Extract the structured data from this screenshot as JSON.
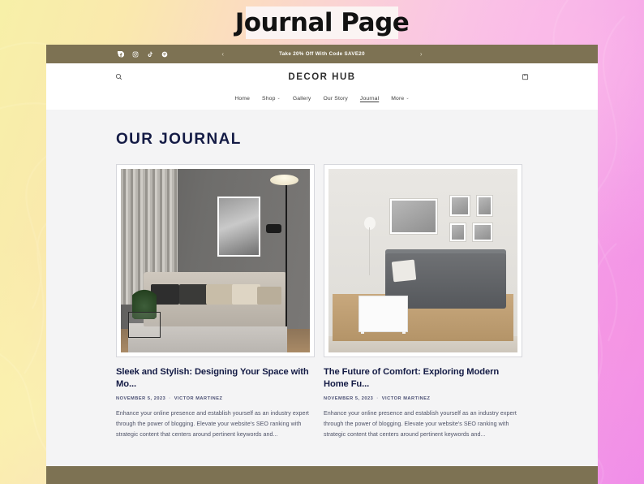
{
  "banner": {
    "title": "Journal Page"
  },
  "announcement": {
    "text": "Take 20% Off With Code SAVE20",
    "prev_label": "‹",
    "next_label": "›",
    "socials": [
      {
        "name": "facebook-icon",
        "label": "Facebook"
      },
      {
        "name": "instagram-icon",
        "label": "Instagram"
      },
      {
        "name": "tiktok-icon",
        "label": "TikTok"
      },
      {
        "name": "pinterest-icon",
        "label": "Pinterest"
      }
    ],
    "background_color": "#7d7253"
  },
  "header": {
    "logo": "DECOR HUB",
    "search_label": "Search",
    "cart_label": "Cart",
    "nav": [
      {
        "label": "Home",
        "has_caret": false,
        "active": false
      },
      {
        "label": "Shop",
        "has_caret": true,
        "active": false
      },
      {
        "label": "Gallery",
        "has_caret": false,
        "active": false
      },
      {
        "label": "Our Story",
        "has_caret": false,
        "active": false
      },
      {
        "label": "Journal",
        "has_caret": false,
        "active": true
      },
      {
        "label": "More",
        "has_caret": true,
        "active": false
      }
    ],
    "caret_glyph": "⌄"
  },
  "main": {
    "page_title": "OUR JOURNAL",
    "title_color": "#141b45",
    "articles": [
      {
        "title": "Sleek and Stylish: Designing Your Space with Mo...",
        "date": "NOVEMBER 5, 2023",
        "separator": "·",
        "author": "VICTOR MARTINEZ",
        "excerpt": "Enhance your online presence and establish yourself as an industry expert through the power of blogging. Elevate your website's SEO ranking with strategic content that centers around pertinent keywords and...",
        "image_alt": "Modern living room with gray sofa, floor lamp and framed art"
      },
      {
        "title": "The Future of Comfort: Exploring Modern Home Fu...",
        "date": "NOVEMBER 5, 2023",
        "separator": "·",
        "author": "VICTOR MARTINEZ",
        "excerpt": "Enhance your online presence and establish yourself as an industry expert through the power of blogging. Elevate your website's SEO ranking with strategic content that centers around pertinent keywords and...",
        "image_alt": "Gray sectional sofa with white coffee table on jute rug"
      }
    ]
  },
  "footer": {
    "background_color": "#7d7253"
  }
}
